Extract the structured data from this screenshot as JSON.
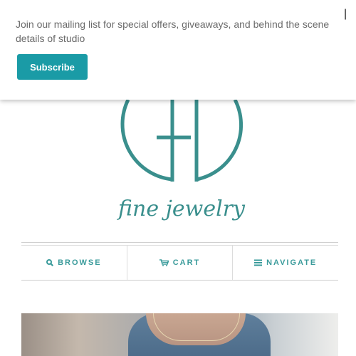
{
  "brand": {
    "logo_icon": "cfd-monogram-logo",
    "logo_text": "fine jewelry",
    "accent_color": "#3a8f8d"
  },
  "popup": {
    "message": "Join our mailing list for special offers, giveaways, and behind the scene details of studio",
    "subscribe_label": "Subscribe",
    "subscribe_color": "#1a9ba6",
    "close_label": "|",
    "close_icon": "close-icon"
  },
  "nav": {
    "items": [
      {
        "label": "BROWSE",
        "icon": "search-icon"
      },
      {
        "label": "CART",
        "icon": "cart-icon"
      },
      {
        "label": "NAVIGATE",
        "icon": "menu-icon"
      }
    ],
    "color": "#3a9b9b"
  }
}
